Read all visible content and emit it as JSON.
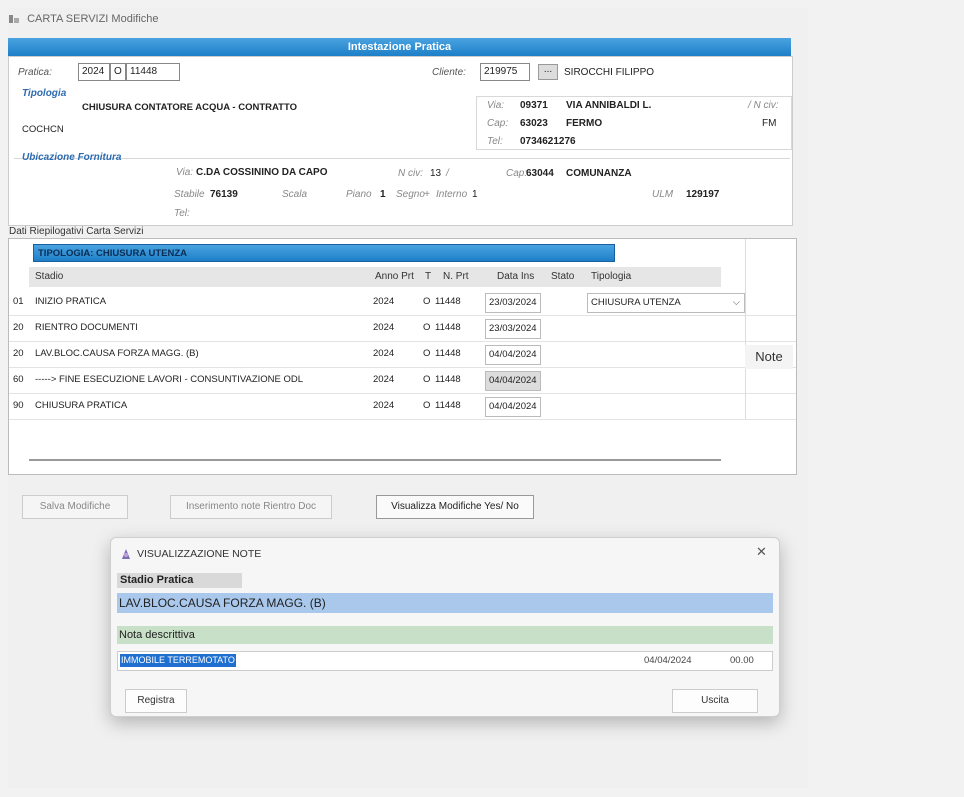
{
  "window": {
    "title": "CARTA SERVIZI Modifiche"
  },
  "header_bar": {
    "title": "Intestazione Pratica"
  },
  "pratica": {
    "label": "Pratica:",
    "anno": "2024",
    "tipo": "O",
    "numero": "11448",
    "cliente_label": "Cliente:",
    "cliente_codice": "219975",
    "lookup_label": "...",
    "cliente_nome": "SIROCCHI FILIPPO"
  },
  "tipologia": {
    "title": "Tipologia",
    "value": "CHIUSURA CONTATORE ACQUA - CONTRATTO",
    "code": "COCHCN"
  },
  "cliente_info": {
    "via_label": "Via:",
    "via_code": "09371",
    "via_name": "VIA ANNIBALDI L.",
    "ncivico_label": "/ N civ:",
    "cap_label": "Cap:",
    "cap": "63023",
    "citta": "FERMO",
    "prov": "FM",
    "tel_label": "Tel:",
    "tel": "0734621276"
  },
  "ubicazione": {
    "title": "Ubicazione Fornitura",
    "via_label": "Via:",
    "via": "C.DA COSSININO DA CAPO",
    "ncivico_label": "N civ:",
    "ncivico": "13",
    "slash": "/",
    "cap_label": "Cap:",
    "cap": "63044",
    "citta": "COMUNANZA",
    "stabile_label": "Stabile",
    "stabile": "76139",
    "scala_label": "Scala",
    "piano_label": "Piano",
    "piano": "1",
    "segno_label": "Segno",
    "segno": "+",
    "interno_label": "Interno",
    "interno": "1",
    "ulm_label": "ULM",
    "ulm": "129197",
    "tel_label": "Tel:"
  },
  "riepilogo": {
    "title": "Dati Riepilogativi Carta Servizi",
    "tipologia_banner": "TIPOLOGIA:   CHIUSURA UTENZA",
    "columns": {
      "stadio": "Stadio",
      "anno": "Anno Prt",
      "t": "T",
      "nprt": "N. Prt",
      "data": "Data Ins",
      "stato": "Stato",
      "tipologia": "Tipologia"
    },
    "rows": [
      {
        "code": "01",
        "stadio": "INIZIO PRATICA",
        "anno": "2024",
        "t": "O",
        "nprt": "11448",
        "data": "23/03/2024",
        "tipologia": "CHIUSURA UTENZA"
      },
      {
        "code": "20",
        "stadio": "RIENTRO DOCUMENTI",
        "anno": "2024",
        "t": "O",
        "nprt": "11448",
        "data": "23/03/2024",
        "tipologia": ""
      },
      {
        "code": "20",
        "stadio": "LAV.BLOC.CAUSA FORZA MAGG. (B)",
        "anno": "2024",
        "t": "O",
        "nprt": "11448",
        "data": "04/04/2024",
        "tipologia": ""
      },
      {
        "code": "60",
        "stadio": "-----> FINE ESECUZIONE LAVORI - CONSUNTIVAZIONE ODL",
        "anno": "2024",
        "t": "O",
        "nprt": "11448",
        "data": "04/04/2024",
        "tipologia": ""
      },
      {
        "code": "90",
        "stadio": "CHIUSURA PRATICA",
        "anno": "2024",
        "t": "O",
        "nprt": "11448",
        "data": "04/04/2024",
        "tipologia": ""
      }
    ],
    "note_button": "Note"
  },
  "buttons": {
    "salva": "Salva Modifiche",
    "inserimento": "Inserimento note Rientro Doc",
    "visualizza": "Visualizza Modifiche Yes/ No"
  },
  "dialog": {
    "title": "VISUALIZZAZIONE NOTE",
    "close": "✕",
    "stadio_label": "Stadio Pratica",
    "stadio_value": "LAV.BLOC.CAUSA FORZA MAGG. (B)",
    "nota_label": "Nota descrittiva",
    "nota_value": "IMMOBILE TERREMOTATO",
    "nota_date": "04/04/2024",
    "nota_time": "00.00",
    "registra": "Registra",
    "uscita": "Uscita"
  },
  "colors": {
    "accent_blue": "#1d7fc8",
    "stadio_bg": "#a9c8ec",
    "nota_bg": "#c8dfc8"
  }
}
